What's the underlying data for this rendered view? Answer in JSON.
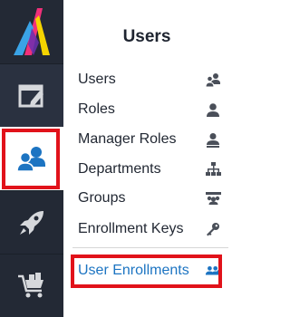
{
  "sidebar": {
    "items": [
      {
        "name": "logo",
        "icon": "app-logo-icon"
      },
      {
        "name": "courses",
        "icon": "window-edit-icon"
      },
      {
        "name": "users",
        "icon": "users-icon",
        "active": true
      },
      {
        "name": "launch",
        "icon": "rocket-icon"
      },
      {
        "name": "store",
        "icon": "shopping-cart-icon"
      }
    ]
  },
  "panel": {
    "title": "Users",
    "items": [
      {
        "label": "Users",
        "icon": "users-icon"
      },
      {
        "label": "Roles",
        "icon": "user-icon"
      },
      {
        "label": "Manager Roles",
        "icon": "manager-icon"
      },
      {
        "label": "Departments",
        "icon": "org-chart-icon"
      },
      {
        "label": "Groups",
        "icon": "group-icon"
      },
      {
        "label": "Enrollment Keys",
        "icon": "key-icon"
      },
      {
        "label": "User Enrollments",
        "icon": "user-enrollments-icon",
        "active": true
      }
    ]
  },
  "colors": {
    "sidebar_bg": "#232935",
    "accent_blue": "#1c74c2",
    "highlight_red": "#e1121a",
    "icon_gray": "#4a4f59"
  }
}
